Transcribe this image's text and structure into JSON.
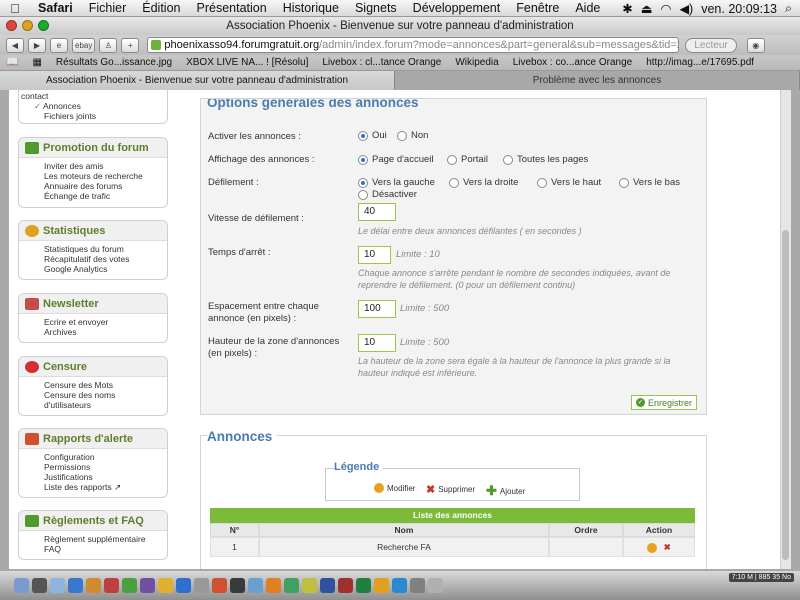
{
  "menubar": {
    "apple": "",
    "app": "Safari",
    "items": [
      "Fichier",
      "Édition",
      "Présentation",
      "Historique",
      "Signets",
      "Développement",
      "Fenêtre",
      "Aide"
    ],
    "clock": "ven. 20:09:13"
  },
  "window": {
    "title": "Association Phoenix - Bienvenue sur votre panneau d'administration"
  },
  "toolbar": {
    "back": "◀",
    "forward": "▶",
    "ebay": "ebay",
    "add": "+",
    "url_domain": "phoenixasso94.forumgratuit.org",
    "url_path": "/admin/index.forum?mode=annonces&part=general&sub=messages&tid=2d",
    "reader": "Lecteur"
  },
  "bookmarks": [
    "Résultats Go...issance.jpg",
    "XBOX LIVE NA... ! [Résolu]",
    "Livebox : cl...tance Orange",
    "Wikipedia",
    "Livebox : co...ance Orange",
    "http://imag...e/17695.pdf"
  ],
  "tabs": [
    {
      "label": "Association Phoenix - Bienvenue sur votre panneau d'administration",
      "active": true
    },
    {
      "label": "Problème avec les annonces",
      "active": false
    }
  ],
  "sidebar": {
    "partial_top": [
      "contact",
      "Annonces",
      "Fichiers joints"
    ],
    "sections": [
      {
        "title": "Promotion du forum",
        "icon": "megaphone-icon",
        "color": "#4f9a2a",
        "items": [
          "Inviter des amis",
          "Les moteurs de recherche",
          "Annuaire des forums",
          "Échange de trafic"
        ]
      },
      {
        "title": "Statistiques",
        "icon": "pie-chart-icon",
        "color": "#e0a020",
        "items": [
          "Statistiques du forum",
          "Récapitulatif des votes",
          "Google Analytics"
        ]
      },
      {
        "title": "Newsletter",
        "icon": "envelope-icon",
        "color": "#c0504d",
        "items": [
          "Ecrire et envoyer",
          "Archives"
        ]
      },
      {
        "title": "Censure",
        "icon": "censor-icon",
        "color": "#d03030",
        "items": [
          "Censure des Mots",
          "Censure des noms d'utilisateurs"
        ]
      },
      {
        "title": "Rapports d'alerte",
        "icon": "alert-icon",
        "color": "#d05030",
        "items": [
          "Configuration",
          "Permissions",
          "Justifications",
          "Liste des rapports"
        ]
      },
      {
        "title": "Règlements et FAQ",
        "icon": "rules-icon",
        "color": "#4f9a2a",
        "items": [
          "Règlement supplémentaire",
          "FAQ"
        ]
      }
    ]
  },
  "options": {
    "title": "Options générales des annonces",
    "activate": {
      "label": "Activer les annonces :",
      "options": [
        "Oui",
        "Non"
      ],
      "selected": "Oui"
    },
    "display": {
      "label": "Affichage des annonces :",
      "options": [
        "Page d'accueil",
        "Portail",
        "Toutes les pages"
      ],
      "selected": "Page d'accueil"
    },
    "scroll": {
      "label": "Défilement :",
      "options": [
        "Vers la gauche",
        "Vers la droite",
        "Vers le haut",
        "Vers le bas",
        "Désactiver"
      ],
      "selected": "Vers la gauche"
    },
    "speed": {
      "label": "Vitesse de défilement :",
      "value": "40",
      "help": "Le délai entre deux annonces défilantes ( en secondes )"
    },
    "pause": {
      "label": "Temps d'arrêt :",
      "value": "10",
      "limit": "Limite : 10",
      "help": "Chaque annonce s'arrête pendant le nombre de secondes indiquées, avant de reprendre le défilement. (0 pour un défilement continu)"
    },
    "spacing": {
      "label": "Espacement entre chaque annonce (en pixels) :",
      "value": "100",
      "limit": "Limite : 500"
    },
    "height": {
      "label": "Hauteur de la zone d'annonces (en pixels) :",
      "value": "10",
      "limit": "Limite : 500",
      "help": "La hauteur de la zone sera égale à la hauteur de l'annonce la plus grande si la hauteur indiqué est inférieure."
    },
    "save": "Enregistrer"
  },
  "annonces": {
    "title": "Annonces",
    "legend_title": "Légende",
    "legend": [
      "Modifier",
      "Supprimer",
      "Ajouter"
    ],
    "table_title": "Liste des annonces",
    "columns": [
      "N°",
      "Nom",
      "Ordre",
      "Action"
    ],
    "rows": [
      {
        "num": "1",
        "name": "Recherche FA",
        "order": ""
      }
    ]
  },
  "dock": {
    "status": "7:10 M | 885 35 No"
  }
}
